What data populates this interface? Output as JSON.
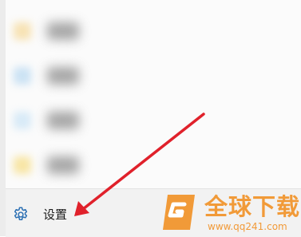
{
  "list": {
    "items": [
      {
        "icon_color": "#f6dca2"
      },
      {
        "icon_color": "#bfdcf2"
      },
      {
        "icon_color": "#cfe6f6"
      },
      {
        "icon_color": "#f7e08f"
      }
    ]
  },
  "footer": {
    "settings_label": "设置",
    "settings_icon": "gear-icon"
  },
  "annotation": {
    "arrow_color": "#e0212b"
  },
  "watermark": {
    "title": "全球下载",
    "url": "www.qq241.com",
    "color": "#f19a38"
  }
}
